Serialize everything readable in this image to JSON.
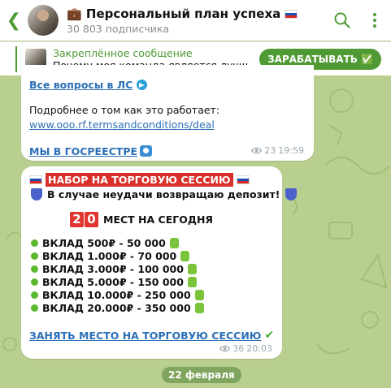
{
  "header": {
    "title": "💼 Персональный план успеха",
    "subtitle": "30 803 подписчика"
  },
  "pinned": {
    "label": "Закреплённое сообщение",
    "message": "Почему моя команда является лучшей...",
    "button": "ЗАРАБАТЫВАТЬ ✅"
  },
  "message1": {
    "ask_link": "Все вопросы в ЛС",
    "more_text": "Подробнее о том как это работает:",
    "terms_link": "www.ooo.rf.termsandconditions/deal",
    "registry_link": "МЫ В ГОСРЕЕСТРЕ",
    "views": "23",
    "time": "19:59"
  },
  "message2": {
    "headline": "НАБОР НА ТОРГОВУЮ СЕССИЮ",
    "guarantee": "В случае неудачи возвращаю депозит!",
    "slots_digits": [
      "2",
      "0"
    ],
    "slots_text": "МЕСТ НА СЕГОДНЯ",
    "offers": [
      "ВКЛАД 500₽ - 50 000",
      "ВКЛАД 1.000₽ - 70 000",
      "ВКЛАД 3.000₽ - 100 000",
      "ВКЛАД 5.000₽ - 150 000",
      "ВКЛАД 10.000₽ - 250 000",
      "ВКЛАД 20.000₽ - 350 000"
    ],
    "cta_link": "ЗАНЯТЬ МЕСТО НА ТОРГОВУЮ СЕССИЮ",
    "views": "36",
    "time": "20:03"
  },
  "date_chip": "22 февраля",
  "colors": {
    "accent": "#4f9a34",
    "link": "#2c6fb6",
    "highlight": "#d9302b"
  }
}
